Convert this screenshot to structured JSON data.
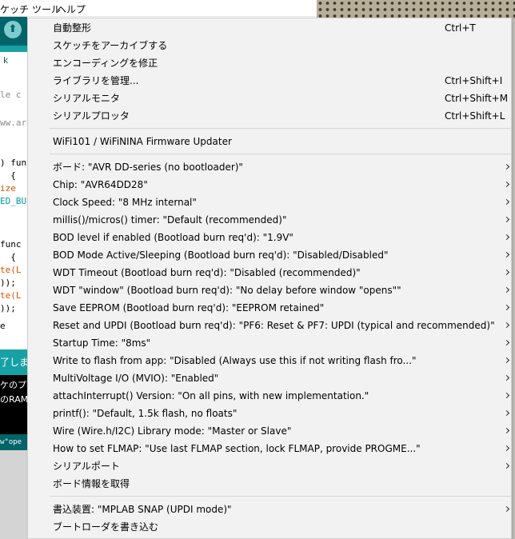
{
  "menubar": {
    "items": [
      "ケッチ",
      "ツール",
      "ヘルプ"
    ]
  },
  "toolbar": {
    "tab_label": "k"
  },
  "editor": {
    "lines": [
      {
        "text": "le c"
      },
      {
        "text": "ww.ar"
      },
      {
        "text": ") fun"
      },
      {
        "text": "  {"
      },
      {
        "text": "ize"
      },
      {
        "text": "ED_BU"
      },
      {
        "text": "func"
      },
      {
        "text": "  {"
      },
      {
        "text": "te(L"
      },
      {
        "text": "));"
      },
      {
        "text": "te(L"
      },
      {
        "text": "));"
      },
      {
        "text": "e"
      }
    ]
  },
  "status_bar": {
    "text": "了しま"
  },
  "console": {
    "lines": [
      "ケのプ",
      "のRAM"
    ]
  },
  "footer_bar": {
    "text": "w\"ope"
  },
  "menu": {
    "section1": [
      {
        "label": "自動整形",
        "shortcut": "Ctrl+T"
      },
      {
        "label": "スケッチをアーカイブする",
        "shortcut": ""
      },
      {
        "label": "エンコーディングを修正",
        "shortcut": ""
      },
      {
        "label": "ライブラリを管理...",
        "shortcut": "Ctrl+Shift+I"
      },
      {
        "label": "シリアルモニタ",
        "shortcut": "Ctrl+Shift+M"
      },
      {
        "label": "シリアルプロッタ",
        "shortcut": "Ctrl+Shift+L"
      }
    ],
    "section2": [
      {
        "label": "WiFi101 / WiFiNINA Firmware Updater"
      }
    ],
    "section3": [
      {
        "label": "ボード: \"AVR DD-series (no bootloader)\"",
        "submenu": true
      },
      {
        "label": "Chip: \"AVR64DD28\"",
        "submenu": true
      },
      {
        "label": "Clock Speed: \"8 MHz internal\"",
        "submenu": true
      },
      {
        "label": "millis()/micros() timer: \"Default (recommended)\"",
        "submenu": true
      },
      {
        "label": "BOD level if enabled (Bootload burn req'd): \"1.9V\"",
        "submenu": true
      },
      {
        "label": "BOD Mode Active/Sleeping (Bootload burn req'd): \"Disabled/Disabled\"",
        "submenu": true
      },
      {
        "label": "WDT Timeout (Bootload burn req'd): \"Disabled (recommended)\"",
        "submenu": true
      },
      {
        "label": "WDT \"window\" (Bootload burn req'd): \"No delay before window \"opens\"\"",
        "submenu": true
      },
      {
        "label": "Save EEPROM (Bootload burn req'd): \"EEPROM retained\"",
        "submenu": true
      },
      {
        "label": "Reset and UPDI (Bootload burn req'd): \"PF6: Reset & PF7: UPDI (typical and recommended)\"",
        "submenu": true
      },
      {
        "label": "Startup Time: \"8ms\"",
        "submenu": true
      },
      {
        "label": "Write to flash from app: \"Disabled (Always use this if not writing flash fro...\"",
        "submenu": true
      },
      {
        "label": "MultiVoltage I/O (MVIO): \"Enabled\"",
        "submenu": true
      },
      {
        "label": "attachInterrupt() Version: \"On all pins, with new implementation.\"",
        "submenu": true
      },
      {
        "label": "printf(): \"Default, 1.5k flash, no floats\"",
        "submenu": true
      },
      {
        "label": "Wire (Wire.h/I2C) Library mode: \"Master or Slave\"",
        "submenu": true
      },
      {
        "label": "How to set FLMAP: \"Use last FLMAP section, lock FLMAP, provide PROGME...\"",
        "submenu": true
      },
      {
        "label": "シリアルポート",
        "submenu": true
      },
      {
        "label": "ボード情報を取得",
        "submenu": false
      }
    ],
    "section4": [
      {
        "label": "書込装置: \"MPLAB SNAP (UPDI mode)\"",
        "submenu": true
      },
      {
        "label": "ブートローダを書き込む",
        "submenu": false
      }
    ]
  },
  "colors": {
    "toolbar_dark_teal": "#006468",
    "tab_teal": "#17a1a5",
    "menu_background": "#f2f2f2"
  },
  "icons": {
    "upload": "upload-arrow-icon",
    "submenu": "chevron-right-icon"
  }
}
